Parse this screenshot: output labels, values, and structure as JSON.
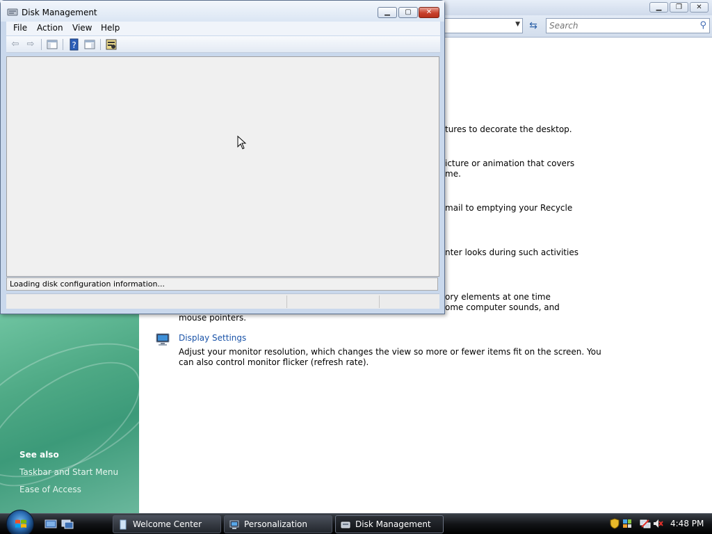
{
  "background_window": {
    "search_placeholder": "Search",
    "description_fragments": [
      "tures to decorate the desktop.",
      "icture or animation that covers",
      "me.",
      "mail to emptying your Recycle",
      "nter looks during such activities",
      "ory elements at one time",
      "ome computer sounds, and",
      "mouse pointers."
    ],
    "display_settings": {
      "title": "Display Settings",
      "desc_line1": "Adjust your monitor resolution, which changes the view so more or fewer items fit on the screen. You",
      "desc_line2": "can also control monitor flicker (refresh rate)."
    },
    "see_also": {
      "heading": "See also",
      "links": [
        "Taskbar and Start Menu",
        "Ease of Access"
      ]
    }
  },
  "disk_management": {
    "title": "Disk Management",
    "menu": [
      "File",
      "Action",
      "View",
      "Help"
    ],
    "toolbar_icons": [
      "back-arrow-icon",
      "forward-arrow-icon",
      "show-hide-console-tree-icon",
      "help-icon",
      "show-hide-action-pane-icon",
      "properties-icon"
    ],
    "status_text": "Loading disk configuration information..."
  },
  "taskbar": {
    "buttons": [
      {
        "label": "Welcome Center",
        "icon": "welcome-center-icon",
        "active": false
      },
      {
        "label": "Personalization",
        "icon": "personalization-icon",
        "active": false
      },
      {
        "label": "Disk Management",
        "icon": "disk-management-icon",
        "active": true
      }
    ],
    "clock": "4:48 PM",
    "tray_icons": [
      "security-shield-icon",
      "windows-sidebar-icon",
      "network-icon",
      "volume-muted-icon"
    ]
  },
  "colors": {
    "link": "#1a53a8",
    "taskbar": "#121417",
    "close_button": "#c8412d",
    "left_pane_green": "#4ea985"
  }
}
